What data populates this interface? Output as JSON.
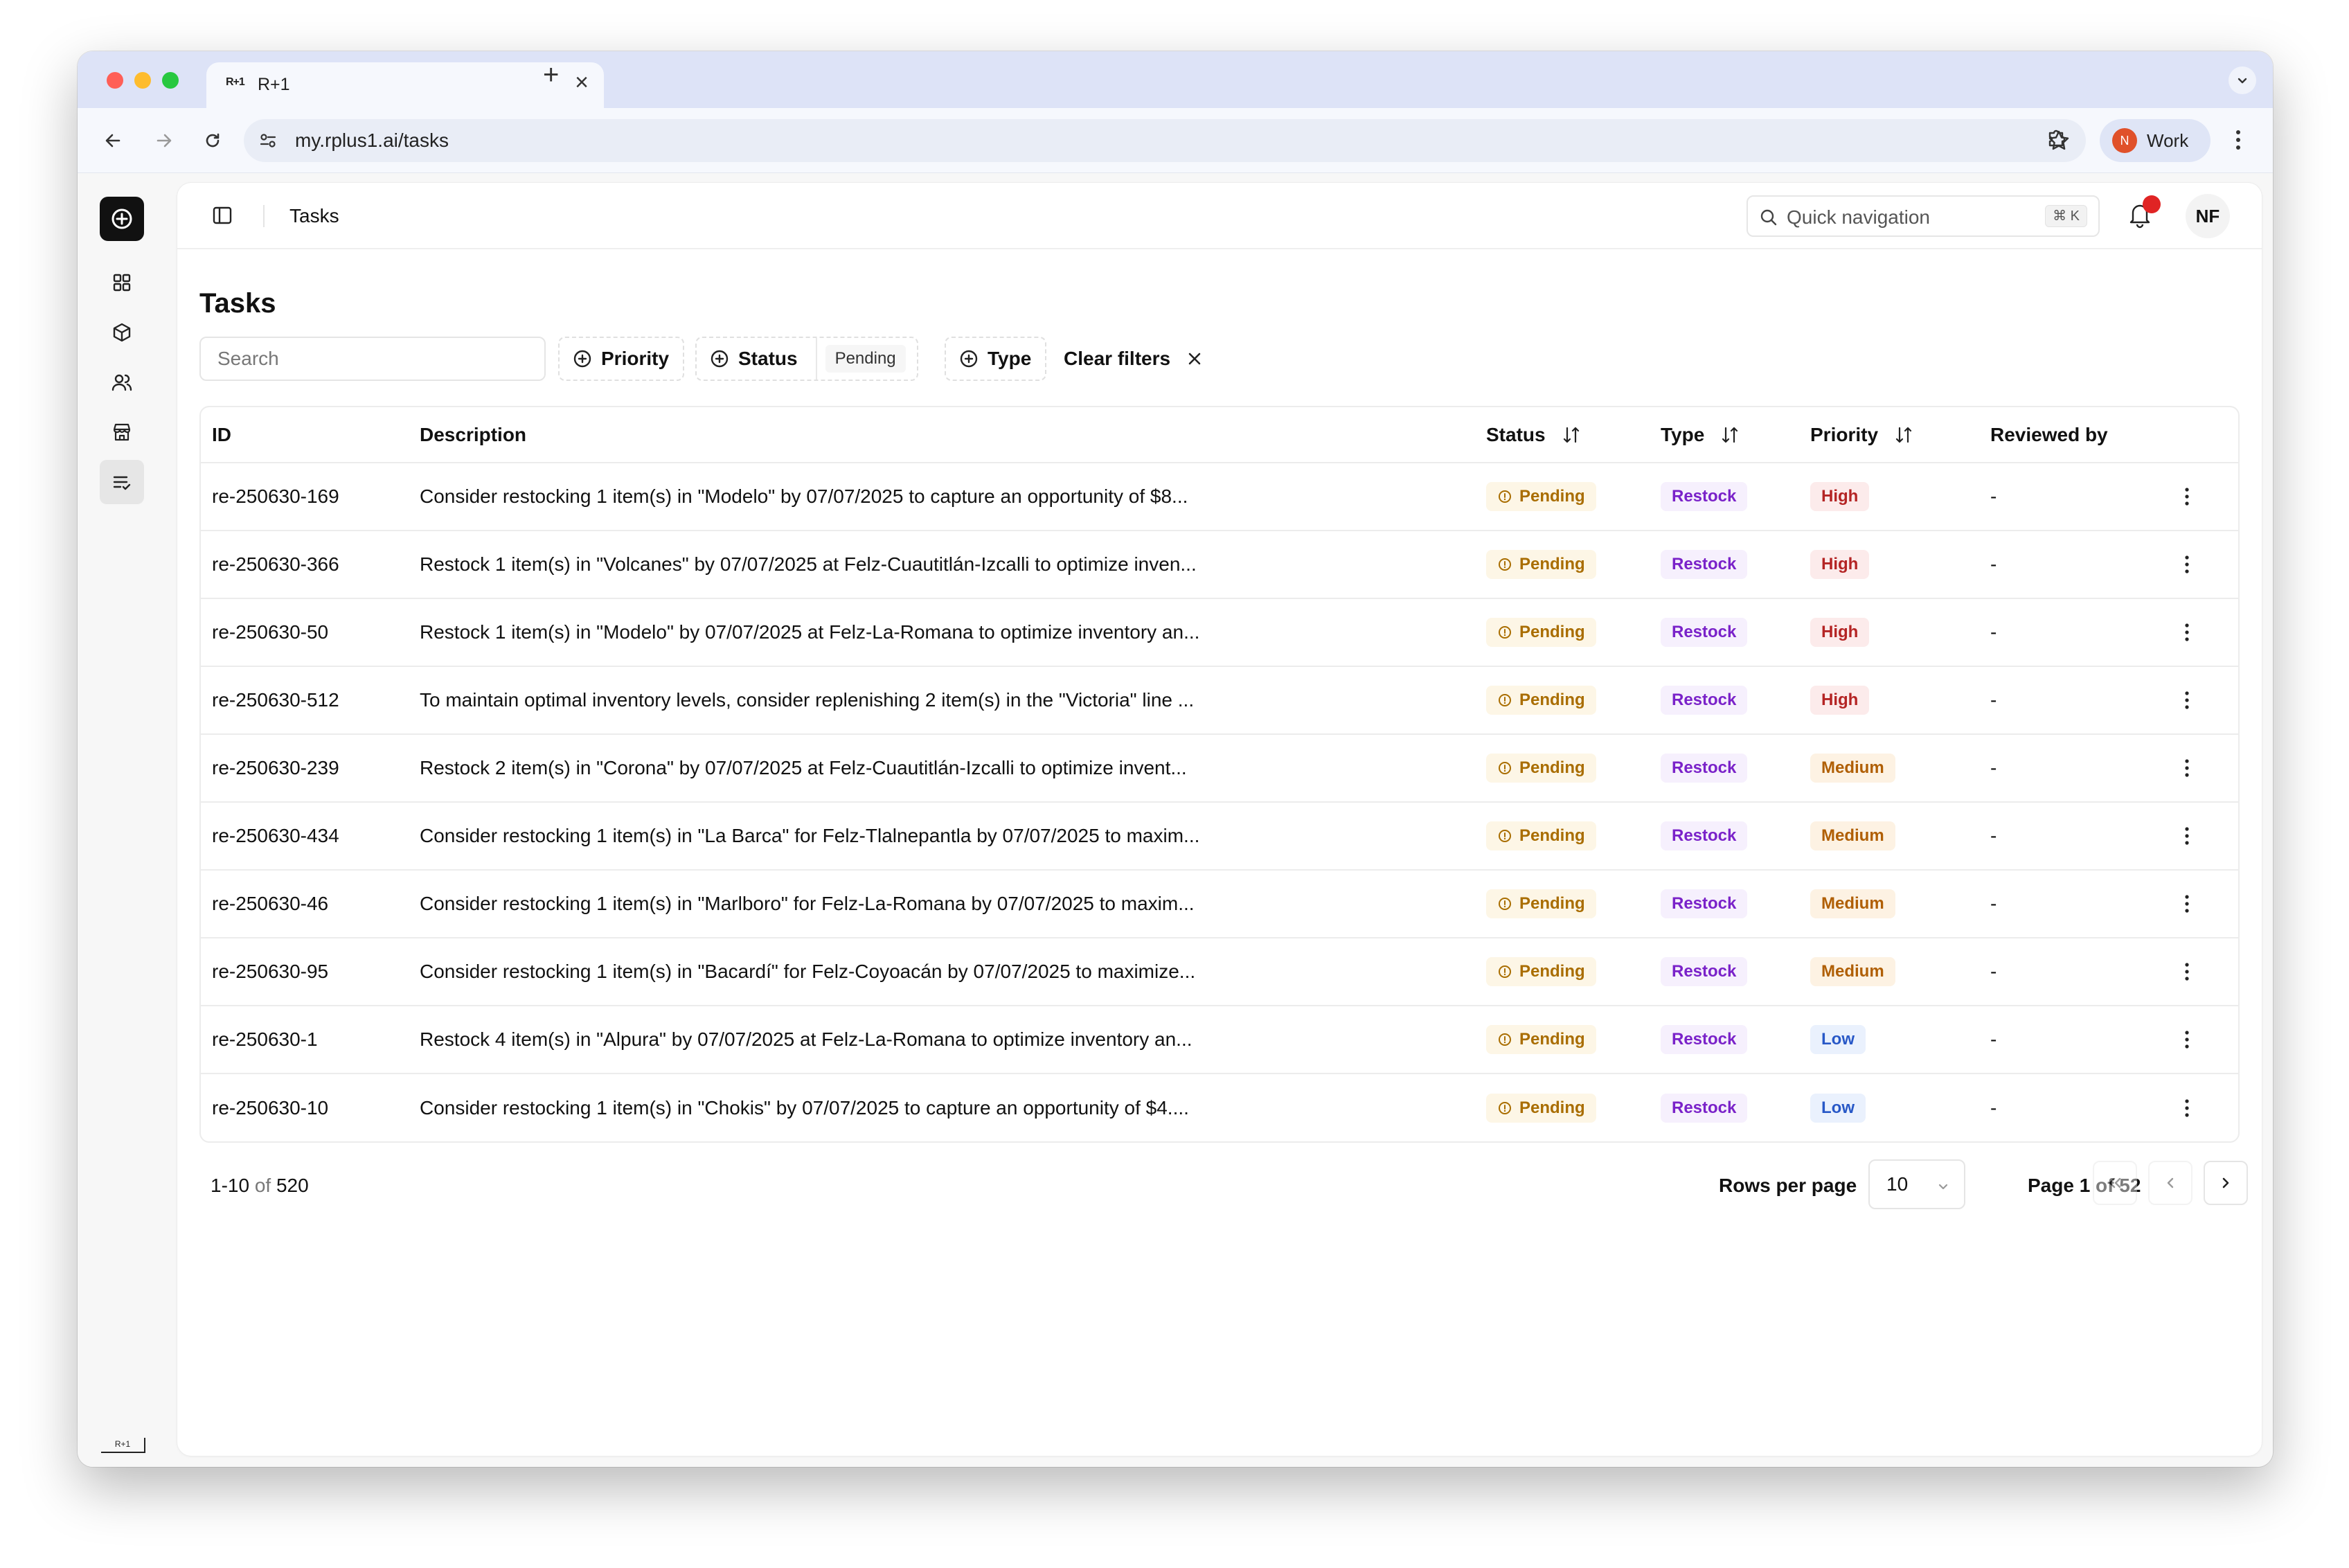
{
  "browser": {
    "tab_title": "R+1",
    "tab_favicon_text": "R+1",
    "url": "my.rplus1.ai/tasks",
    "profile_initial": "N",
    "profile_name": "Work"
  },
  "header": {
    "title": "Tasks",
    "quick_nav_placeholder": "Quick navigation",
    "quick_nav_shortcut": "⌘ K",
    "user_initials": "NF"
  },
  "sidebar": {
    "items": [
      {
        "icon": "dashboard-icon"
      },
      {
        "icon": "package-icon"
      },
      {
        "icon": "users-icon"
      },
      {
        "icon": "store-icon"
      },
      {
        "icon": "tasks-list-icon",
        "active": true
      }
    ],
    "footer_logo_text": "R+1"
  },
  "page": {
    "title": "Tasks",
    "search_placeholder": "Search",
    "filters": {
      "priority_label": "Priority",
      "status_label": "Status",
      "status_selected": "Pending",
      "type_label": "Type",
      "clear_label": "Clear filters"
    }
  },
  "table": {
    "columns": {
      "id": "ID",
      "description": "Description",
      "status": "Status",
      "type": "Type",
      "priority": "Priority",
      "reviewed_by": "Reviewed by"
    },
    "rows": [
      {
        "id": "re-250630-169",
        "description": "Consider restocking 1 item(s) in \"Modelo\" by 07/07/2025 to capture an opportunity of $8...",
        "status": "Pending",
        "type": "Restock",
        "priority": "High",
        "reviewed_by": "-"
      },
      {
        "id": "re-250630-366",
        "description": "Restock 1 item(s) in \"Volcanes\" by 07/07/2025 at Felz-Cuautitlán-Izcalli to optimize inven...",
        "status": "Pending",
        "type": "Restock",
        "priority": "High",
        "reviewed_by": "-"
      },
      {
        "id": "re-250630-50",
        "description": "Restock 1 item(s) in \"Modelo\" by 07/07/2025 at Felz-La-Romana to optimize inventory an...",
        "status": "Pending",
        "type": "Restock",
        "priority": "High",
        "reviewed_by": "-"
      },
      {
        "id": "re-250630-512",
        "description": "To maintain optimal inventory levels, consider replenishing 2 item(s) in the \"Victoria\" line ...",
        "status": "Pending",
        "type": "Restock",
        "priority": "High",
        "reviewed_by": "-"
      },
      {
        "id": "re-250630-239",
        "description": "Restock 2 item(s) in \"Corona\" by 07/07/2025 at Felz-Cuautitlán-Izcalli to optimize invent...",
        "status": "Pending",
        "type": "Restock",
        "priority": "Medium",
        "reviewed_by": "-"
      },
      {
        "id": "re-250630-434",
        "description": "Consider restocking 1 item(s) in \"La Barca\" for Felz-Tlalnepantla by 07/07/2025 to maxim...",
        "status": "Pending",
        "type": "Restock",
        "priority": "Medium",
        "reviewed_by": "-"
      },
      {
        "id": "re-250630-46",
        "description": "Consider restocking 1 item(s) in \"Marlboro\" for Felz-La-Romana by 07/07/2025 to maxim...",
        "status": "Pending",
        "type": "Restock",
        "priority": "Medium",
        "reviewed_by": "-"
      },
      {
        "id": "re-250630-95",
        "description": "Consider restocking 1 item(s) in \"Bacardí\" for Felz-Coyoacán by 07/07/2025 to maximize...",
        "status": "Pending",
        "type": "Restock",
        "priority": "Medium",
        "reviewed_by": "-"
      },
      {
        "id": "re-250630-1",
        "description": "Restock 4 item(s) in \"Alpura\" by 07/07/2025 at Felz-La-Romana to optimize inventory an...",
        "status": "Pending",
        "type": "Restock",
        "priority": "Low",
        "reviewed_by": "-"
      },
      {
        "id": "re-250630-10",
        "description": "Consider restocking 1 item(s) in \"Chokis\" by 07/07/2025 to capture an opportunity of $4....",
        "status": "Pending",
        "type": "Restock",
        "priority": "Low",
        "reviewed_by": "-"
      }
    ]
  },
  "pagination": {
    "range": "1-10",
    "of_word": "of",
    "total": "520",
    "rows_per_page_label": "Rows per page",
    "rows_per_page_value": "10",
    "page_label": "Page 1 of 52"
  },
  "colors": {
    "pending": "#a96d00",
    "restock": "#7a22c9",
    "high": "#b42424",
    "medium": "#b05f05",
    "low": "#2858c7",
    "notification_dot": "#e02424"
  }
}
